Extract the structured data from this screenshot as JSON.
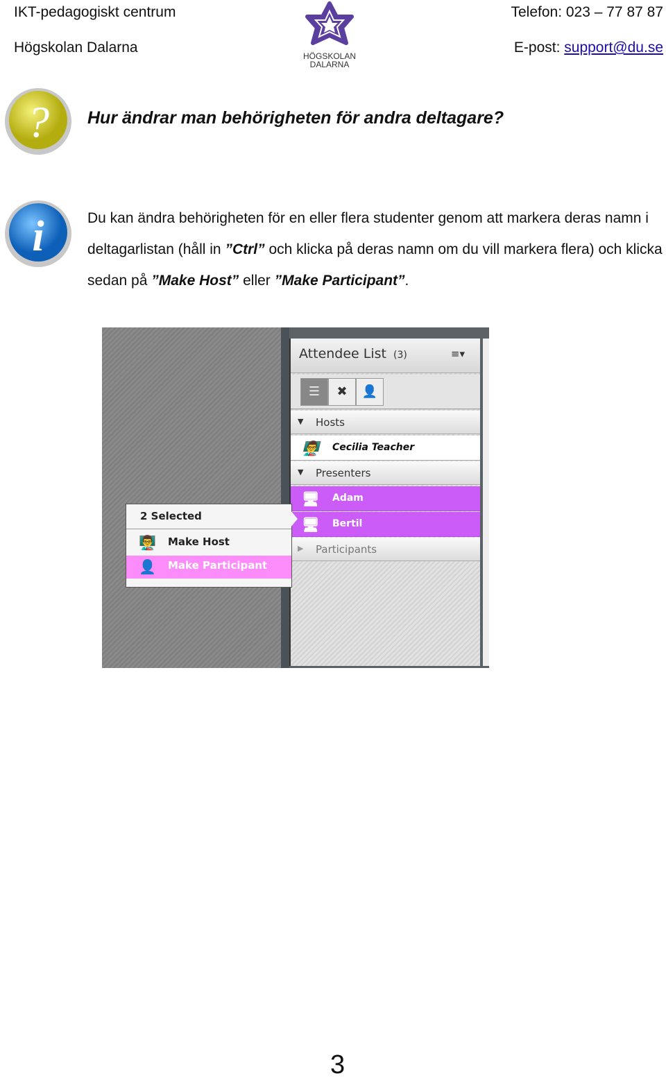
{
  "header": {
    "org": "IKT-pedagogiskt centrum",
    "school": "Högskolan Dalarna",
    "phone": "Telefon: 023 – 77 87 87",
    "email_label": "E-post: ",
    "email": "support@du.se",
    "logo_text": [
      "HÖGSKOLAN",
      "DALARNA"
    ],
    "logo_color": "#5b3f9e"
  },
  "question": {
    "icon": "question-icon",
    "text": "Hur ändrar man behörigheten för andra deltagare?"
  },
  "info": {
    "icon": "info-icon",
    "p1": "Du kan ändra behörigheten för en eller flera studenter genom att markera deras namn i deltagarlistan (håll in ",
    "ctrl": "”Ctrl”",
    "p2": " och klicka på deras namn om du vill markera flera) och klicka sedan på ",
    "make_host": "”Make Host”",
    "p3": " eller ",
    "make_participant": "”Make Participant”",
    "p4": "."
  },
  "screenshot": {
    "panel_title": "Attendee List",
    "count": "(3)",
    "sections": {
      "hosts": "Hosts",
      "presenters": "Presenters",
      "participants": "Participants"
    },
    "hosts": [
      "Cecilia Teacher"
    ],
    "presenters": [
      "Adam",
      "Bertil"
    ],
    "popup": {
      "title": "2 Selected",
      "make_host": "Make Host",
      "make_participant": "Make Participant"
    },
    "selection_color": "#cc5cf8",
    "highlight_color": "#fd8cfb"
  },
  "page_number": "3"
}
